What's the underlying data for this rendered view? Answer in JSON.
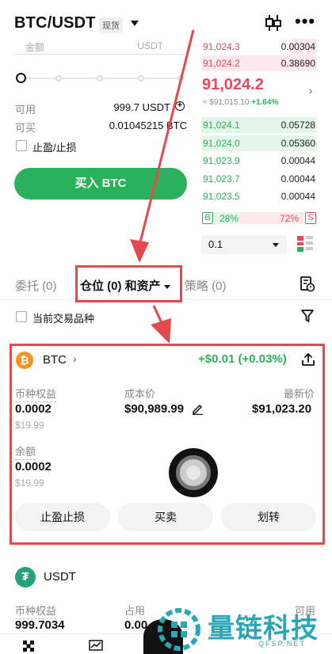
{
  "header": {
    "pair": "BTC/USDT",
    "badge": "现货"
  },
  "order_form": {
    "amount_label": "金额",
    "amount_unit": "USDT",
    "slider_percent": 0,
    "available_label": "可用",
    "available_value": "999.7 USDT",
    "can_buy_label": "可买",
    "can_buy_value": "0.01045215 BTC",
    "tpsl_label": "止盈/止损",
    "buy_button": "买入 BTC"
  },
  "order_book": {
    "asks": [
      {
        "price": "91,024.3",
        "qty": "0.00304"
      },
      {
        "price": "91,024.2",
        "qty": "0.38690"
      }
    ],
    "last_price": "91,024.2",
    "index_price": "≈ $91,015.10",
    "change": "+1.64%",
    "bids": [
      {
        "price": "91,024.1",
        "qty": "0.05728"
      },
      {
        "price": "91,024.0",
        "qty": "0.05360"
      },
      {
        "price": "91,023.9",
        "qty": "0.00044"
      },
      {
        "price": "91,023.7",
        "qty": "0.00044"
      },
      {
        "price": "91,023.5",
        "qty": "0.00044"
      }
    ],
    "buy_label": "B",
    "sell_label": "S",
    "buy_ratio": "28%",
    "sell_ratio": "72%",
    "depth": "0.1"
  },
  "tabs": {
    "orders": "委托 (0)",
    "positions": "仓位 (0) 和资产",
    "strategies": "策略 (0)"
  },
  "filter": {
    "current_pair_only": "当前交易品种"
  },
  "btc_card": {
    "symbol": "BTC",
    "pnl": "+$0.01 (+0.03%)",
    "equity_label": "币种权益",
    "equity_value": "0.0002",
    "equity_usd": "$19.99",
    "cost_label": "成本价",
    "cost_value": "$90,989.99",
    "last_label": "最新价",
    "last_value": "$91,023.20",
    "balance_label": "余额",
    "balance_value": "0.0002",
    "balance_usd": "$19.99",
    "btn_tpsl": "止盈止损",
    "btn_trade": "买卖",
    "btn_transfer": "划转"
  },
  "usdt_card": {
    "symbol": "USDT",
    "equity_label": "币种权益",
    "equity_value": "999.7034",
    "occupied_label": "占用",
    "occupied_value": "0.00",
    "available_label": "可用"
  },
  "watermark": {
    "text": "量链科技",
    "url": "QFSP.NET"
  },
  "colors": {
    "green": "#2bb05b",
    "red": "#e5485f",
    "annotation": "#e5484d",
    "watermark": "#2aa7b4"
  }
}
